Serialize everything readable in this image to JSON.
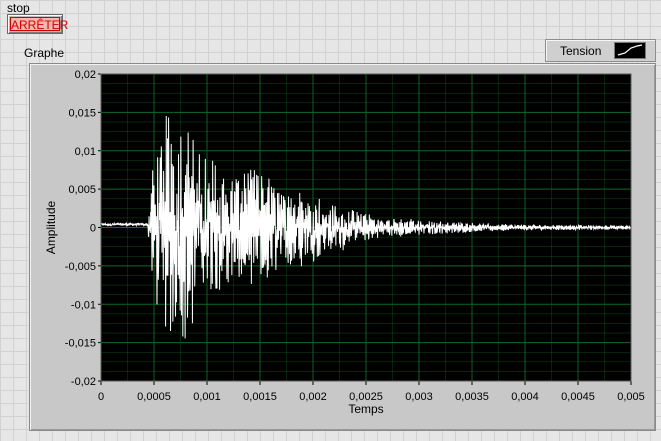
{
  "stop": {
    "label": "stop",
    "button_text": "ARRÊTER"
  },
  "graph": {
    "label": "Graphe",
    "legend_name": "Tension"
  },
  "colors": {
    "plot_background": "#000000",
    "grid": "#0f6b26",
    "trace": "#ffffff",
    "button_text": "#d10000"
  },
  "chart_data": {
    "type": "line",
    "title": "",
    "xlabel": "Temps",
    "ylabel": "Amplitude",
    "xlim": [
      0,
      0.005
    ],
    "ylim": [
      -0.02,
      0.02
    ],
    "x_ticks": [
      "0",
      "0,0005",
      "0,001",
      "0,0015",
      "0,002",
      "0,0025",
      "0,003",
      "0,0035",
      "0,004",
      "0,0045",
      "0,005"
    ],
    "y_ticks": [
      "0,02",
      "0,015",
      "0,01",
      "0,005",
      "0",
      "-0,005",
      "-0,01",
      "-0,015",
      "-0,02"
    ],
    "grid": true,
    "legend_position": "top-right",
    "series": [
      {
        "name": "Tension",
        "envelope": [
          {
            "t": 0.0,
            "amp": 0.0003
          },
          {
            "t": 0.00044,
            "amp": 0.0003
          },
          {
            "t": 0.00048,
            "amp": 0.006
          },
          {
            "t": 0.0006,
            "amp": 0.0115
          },
          {
            "t": 0.0008,
            "amp": 0.0118
          },
          {
            "t": 0.001,
            "amp": 0.0075
          },
          {
            "t": 0.0013,
            "amp": 0.0065
          },
          {
            "t": 0.0016,
            "amp": 0.0055
          },
          {
            "t": 0.002,
            "amp": 0.0035
          },
          {
            "t": 0.0025,
            "amp": 0.0015
          },
          {
            "t": 0.003,
            "amp": 0.0008
          },
          {
            "t": 0.0035,
            "amp": 0.0005
          },
          {
            "t": 0.004,
            "amp": 0.0003
          },
          {
            "t": 0.005,
            "amp": 0.0002
          }
        ]
      }
    ]
  }
}
